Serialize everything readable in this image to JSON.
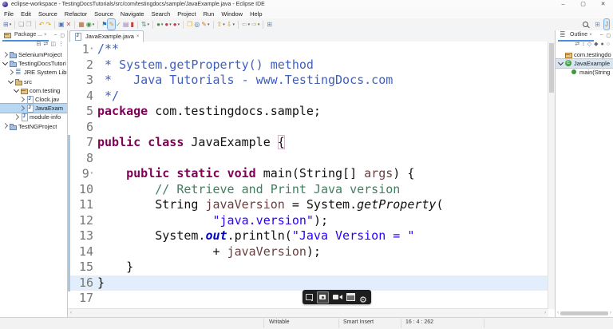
{
  "window": {
    "title": "eclipse-workspace - TestingDocsTutorials/src/com/testingdocs/sample/JavaExample.java - Eclipse IDE",
    "minimize": "–",
    "maximize": "▢",
    "close": "✕"
  },
  "menubar": [
    "File",
    "Edit",
    "Source",
    "Refactor",
    "Source",
    "Navigate",
    "Search",
    "Project",
    "Run",
    "Window",
    "Help"
  ],
  "toolbar": {
    "icons": [
      {
        "n": "new-wizard",
        "g": "⊞",
        "c": "#5b79b4",
        "dd": 1
      },
      {
        "n": "save",
        "g": "❑",
        "c": "#98a2b0",
        "sep": 1
      },
      {
        "n": "save-all",
        "g": "❒",
        "c": "#aab2bc"
      },
      {
        "n": "undo",
        "g": "↶",
        "c": "#d7a61c",
        "sep": 1
      },
      {
        "n": "redo",
        "g": "↷",
        "c": "#d7a61c"
      },
      {
        "n": "open-element",
        "g": "▣",
        "c": "#4a79c0",
        "sep": 1
      },
      {
        "n": "cut",
        "g": "✕",
        "c": "#b8554f"
      },
      {
        "n": "new-java-project",
        "g": "▦",
        "c": "#b06a34",
        "sep": 1
      },
      {
        "n": "new-java-class",
        "g": "◉",
        "c": "#3c9a46",
        "dd": 1
      },
      {
        "n": "debug-flag",
        "g": "⚑",
        "c": "#2f6fb0",
        "sep": 1
      },
      {
        "n": "java-editor",
        "g": "✎",
        "c": "#e09a28",
        "hl": 1
      },
      {
        "n": "format",
        "g": "✓",
        "c": "#8aa05a"
      },
      {
        "n": "task",
        "g": "▤",
        "c": "#9a78b8"
      },
      {
        "n": "terminate",
        "g": "▮",
        "c": "#c24040"
      },
      {
        "n": "synchronize",
        "g": "⇅",
        "c": "#3d9a8c",
        "dd": 1,
        "sep": 1
      },
      {
        "n": "run",
        "g": "●",
        "c": "#2f9b3e",
        "dd": 1,
        "sep": 1
      },
      {
        "n": "debug-run",
        "g": "●",
        "c": "#c23b4e",
        "dd": 1
      },
      {
        "n": "coverage",
        "g": "●",
        "c": "#c23b4e",
        "dd": 1
      },
      {
        "n": "open-resource",
        "g": "❒",
        "c": "#d7b040",
        "sep": 1
      },
      {
        "n": "search",
        "g": "◎",
        "c": "#3b6fae"
      },
      {
        "n": "edit-config",
        "g": "✎",
        "c": "#d07c2c",
        "dd": 1
      },
      {
        "n": "prev-annotation",
        "g": "⇧",
        "c": "#c8a020",
        "dd": 1,
        "sep": 1
      },
      {
        "n": "next-annotation",
        "g": "⇩",
        "c": "#c8a020",
        "dd": 1
      },
      {
        "n": "back",
        "g": "⇦",
        "c": "#d7a61c",
        "dd": 1,
        "sep": 1
      },
      {
        "n": "forward",
        "g": "⇨",
        "c": "#d7a61c",
        "dd": 1
      },
      {
        "n": "open-perspective-new",
        "g": "⊞",
        "c": "#7a8aa0",
        "sep": 1
      }
    ],
    "right": [
      {
        "n": "quick-access-search",
        "g": "mag"
      },
      {
        "n": "open-perspective",
        "g": "⊞",
        "c": "#8a94a4"
      },
      {
        "n": "java-perspective",
        "g": "J",
        "c": "#d07828",
        "hl": 1
      }
    ]
  },
  "package_explorer": {
    "tab": "Package ...",
    "close": "×",
    "minimize": "‒",
    "maximize": "▢",
    "toolbar": [
      {
        "n": "collapse-all",
        "g": "⊟"
      },
      {
        "n": "link-with-editor",
        "g": "⇄"
      },
      {
        "n": "focus-on-active-task",
        "g": "◫"
      },
      {
        "n": "view-menu",
        "g": "⋮"
      }
    ],
    "items": [
      {
        "label": "SeleniumProject",
        "level": 0,
        "icon": "java-project",
        "expanded": false
      },
      {
        "label": "TestingDocsTutori",
        "level": 0,
        "icon": "java-project",
        "expanded": true
      },
      {
        "label": "JRE System Libr",
        "level": 1,
        "icon": "library",
        "expanded": false
      },
      {
        "label": "src",
        "level": 1,
        "icon": "src-folder",
        "expanded": true
      },
      {
        "label": "com.testing",
        "level": 2,
        "icon": "package",
        "expanded": true
      },
      {
        "label": "Clock.jav",
        "level": 3,
        "icon": "java-file",
        "expanded": false
      },
      {
        "label": "JavaExam",
        "level": 3,
        "icon": "java-file",
        "expanded": false,
        "selected": true
      },
      {
        "label": "module-info",
        "level": 2,
        "icon": "java-file",
        "expanded": false
      },
      {
        "label": "TestNGProject",
        "level": 0,
        "icon": "java-project",
        "expanded": false
      }
    ]
  },
  "editor": {
    "tab": "JavaExample.java",
    "close": "×",
    "current_line": 16,
    "lines": [
      {
        "n": 1,
        "fold": true,
        "tokens": [
          [
            "d",
            "/**"
          ]
        ]
      },
      {
        "n": 2,
        "tokens": [
          [
            "d",
            " * System.getProperty() method"
          ]
        ]
      },
      {
        "n": 3,
        "tokens": [
          [
            "d",
            " *   Java Tutorials - www.TestingDocs.com"
          ]
        ]
      },
      {
        "n": 4,
        "tokens": [
          [
            "d",
            " */"
          ]
        ]
      },
      {
        "n": 5,
        "tokens": [
          [
            "k",
            "package"
          ],
          [
            "p",
            " com.testingdocs.sample;"
          ]
        ]
      },
      {
        "n": 6,
        "tokens": []
      },
      {
        "n": 7,
        "tokens": [
          [
            "k",
            "public"
          ],
          [
            "p",
            " "
          ],
          [
            "k",
            "class"
          ],
          [
            "p",
            " JavaExample "
          ],
          [
            "br",
            "{"
          ]
        ]
      },
      {
        "n": 8,
        "tokens": []
      },
      {
        "n": 9,
        "fold": true,
        "tokens": [
          [
            "p",
            "    "
          ],
          [
            "k",
            "public"
          ],
          [
            "p",
            " "
          ],
          [
            "k",
            "static"
          ],
          [
            "p",
            " "
          ],
          [
            "k",
            "void"
          ],
          [
            "p",
            " main(String[] "
          ],
          [
            "v",
            "args"
          ],
          [
            "p",
            ") {"
          ]
        ]
      },
      {
        "n": 10,
        "tokens": [
          [
            "p",
            "        "
          ],
          [
            "c",
            "// Retrieve and Print Java version"
          ]
        ]
      },
      {
        "n": 11,
        "tokens": [
          [
            "p",
            "        String "
          ],
          [
            "v",
            "javaVersion"
          ],
          [
            "p",
            " = System."
          ],
          [
            "i",
            "getProperty"
          ],
          [
            "p",
            "("
          ]
        ]
      },
      {
        "n": 12,
        "tokens": [
          [
            "p",
            "                "
          ],
          [
            "s",
            "\"java.version\""
          ],
          [
            "p",
            ");"
          ]
        ]
      },
      {
        "n": 13,
        "tokens": [
          [
            "p",
            "        System."
          ],
          [
            "b",
            "out"
          ],
          [
            "p",
            ".println("
          ],
          [
            "s",
            "\"Java Version = \""
          ]
        ]
      },
      {
        "n": 14,
        "tokens": [
          [
            "p",
            "                + "
          ],
          [
            "v",
            "javaVersion"
          ],
          [
            "p",
            ");"
          ]
        ]
      },
      {
        "n": 15,
        "tokens": [
          [
            "p",
            "    }"
          ]
        ]
      },
      {
        "n": 16,
        "tokens": [
          [
            "p",
            "}"
          ]
        ]
      },
      {
        "n": 17,
        "tokens": []
      }
    ],
    "hscroll_left_arrow": "‹",
    "hscroll_right_arrow": "›"
  },
  "overlay": {
    "icons": [
      "screen-pin",
      "camera",
      "video-camera",
      "window-capture",
      "gear"
    ]
  },
  "outline": {
    "tab": "Outline",
    "close": "×",
    "minimize": "‒",
    "maximize": "▢",
    "toolbar": [
      {
        "n": "link-with-editor",
        "g": "⇄"
      },
      {
        "n": "sort",
        "g": "↕"
      },
      {
        "n": "hide-fields",
        "g": "◇"
      },
      {
        "n": "hide-static-members",
        "g": "◆"
      },
      {
        "n": "hide-non-public",
        "g": "●"
      },
      {
        "n": "hide-local-types",
        "g": "○"
      }
    ],
    "items": [
      {
        "label": "com.testingdo",
        "level": 0,
        "icon": "package",
        "arrow": false
      },
      {
        "label": "JavaExample",
        "level": 0,
        "icon": "class",
        "expanded": true,
        "selected": true
      },
      {
        "label": "main(String",
        "level": 1,
        "icon": "method",
        "arrow": false
      }
    ]
  },
  "status_bar": {
    "writable": "Writable",
    "insert_mode": "Smart Insert",
    "position": "16 : 4 : 262"
  },
  "colors": {
    "keyword": "#7F0055",
    "doc_comment": "#3F5FBF",
    "comment": "#3F7F5F",
    "string": "#2A00FF",
    "variable": "#6A3E3E",
    "static_field": "#0000C0",
    "current_line_bg": "#E2EEFB",
    "selection_bg": "#B7D7F2",
    "range_indicator": "#A8C7E0"
  }
}
